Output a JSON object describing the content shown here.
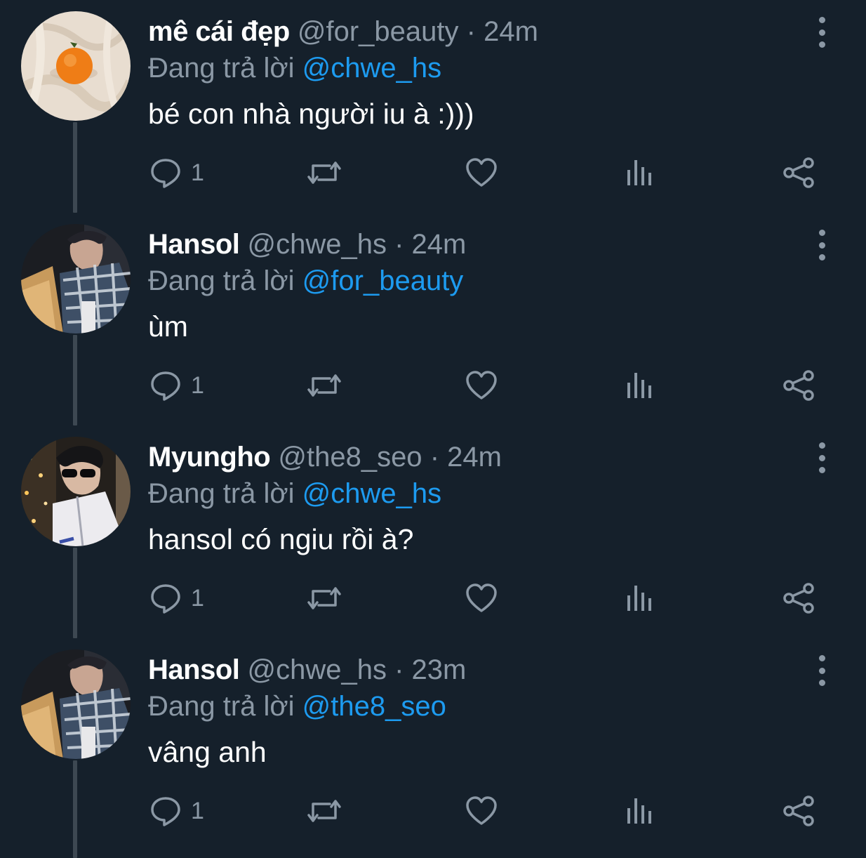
{
  "tweets": [
    {
      "display_name": "mê cái đẹp",
      "handle": "@for_beauty",
      "separator": "·",
      "time": "24m",
      "replying_prefix": "Đang trả lời",
      "replying_to": "@chwe_hs",
      "text": "bé con nhà người iu à :)))",
      "reply_count": "1",
      "avatar": "orange-on-linen"
    },
    {
      "display_name": "Hansol",
      "handle": "@chwe_hs",
      "separator": "·",
      "time": "24m",
      "replying_prefix": "Đang trả lời",
      "replying_to": "@for_beauty",
      "text": "ùm",
      "reply_count": "1",
      "avatar": "plaid-scarf-person"
    },
    {
      "display_name": "Myungho",
      "handle": "@the8_seo",
      "separator": "·",
      "time": "24m",
      "replying_prefix": "Đang trả lời",
      "replying_to": "@chwe_hs",
      "text": "hansol có ngiu rồi à?",
      "reply_count": "1",
      "avatar": "sunglasses-person-night"
    },
    {
      "display_name": "Hansol",
      "handle": "@chwe_hs",
      "separator": "·",
      "time": "23m",
      "replying_prefix": "Đang trả lời",
      "replying_to": "@the8_seo",
      "text": "vâng anh",
      "reply_count": "1",
      "avatar": "plaid-scarf-person"
    }
  ],
  "icons": {
    "reply": "speech-bubble-icon",
    "retweet": "retweet-icon",
    "like": "heart-icon",
    "views": "bar-chart-icon",
    "share": "share-icon",
    "more": "vertical-dots-icon"
  },
  "colors": {
    "background": "#15202b",
    "text": "#ffffff",
    "muted": "#8b98a5",
    "accent": "#1d9bf0",
    "thread_line": "#3d4852"
  }
}
